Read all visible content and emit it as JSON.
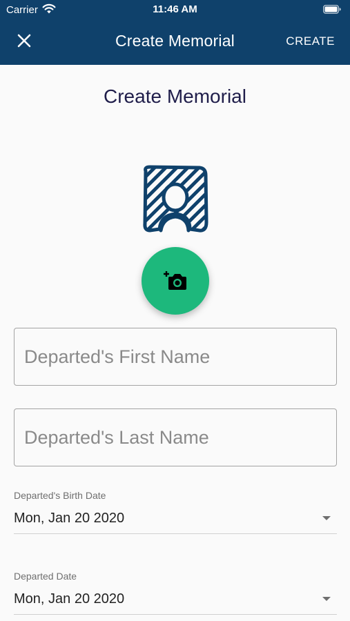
{
  "status_bar": {
    "carrier": "Carrier",
    "time": "11:46 AM"
  },
  "app_bar": {
    "title": "Create Memorial",
    "create_label": "CREATE",
    "close_icon": "close-icon",
    "background": "#0f416b"
  },
  "page": {
    "title": "Create Memorial",
    "avatar_icon": "person-placeholder-icon",
    "add_photo_icon": "add-photo-camera-icon",
    "fab_color": "#1db87c"
  },
  "form": {
    "first_name_placeholder": "Departed's First Name",
    "last_name_placeholder": "Departed's Last Name",
    "birth_date_label": "Departed's Birth Date",
    "birth_date_value": "Mon, Jan 20 2020",
    "departed_date_label": "Departed Date",
    "departed_date_value": "Mon, Jan 20 2020"
  }
}
